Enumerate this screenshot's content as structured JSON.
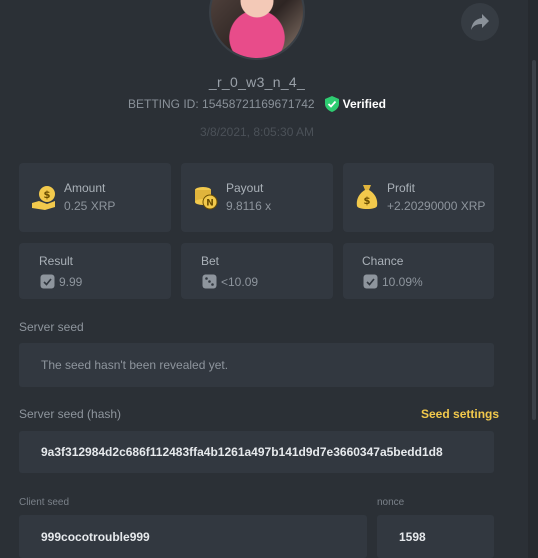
{
  "profile": {
    "username": "_r_0_w3_n_4_",
    "betting_id_label": "BETTING ID:",
    "betting_id": "15458721169671742",
    "verified_label": "Verified",
    "timestamp": "3/8/2021, 8:05:30 AM"
  },
  "stats": {
    "amount": {
      "label": "Amount",
      "value": "0.25 XRP"
    },
    "payout": {
      "label": "Payout",
      "value": "9.8116 x"
    },
    "profit": {
      "label": "Profit",
      "value": "+2.20290000 XRP"
    },
    "result": {
      "label": "Result",
      "value": "9.99"
    },
    "bet": {
      "label": "Bet",
      "value": "<10.09"
    },
    "chance": {
      "label": "Chance",
      "value": "10.09%"
    }
  },
  "server_seed": {
    "label": "Server seed",
    "value": "The seed hasn't been revealed yet."
  },
  "server_seed_hash": {
    "label": "Server seed (hash)",
    "value": "9a3f312984d2c686f112483ffa4b1261a497b141d9d7e3660347a5bedd1d8",
    "settings_label": "Seed settings"
  },
  "client_seed": {
    "label": "Client seed",
    "value": "999cocotrouble999"
  },
  "nonce": {
    "label": "nonce",
    "value": "1598"
  },
  "colors": {
    "accent": "#f2c94c",
    "verified": "#2ecc71",
    "background": "#2b3036",
    "card": "#323840"
  }
}
